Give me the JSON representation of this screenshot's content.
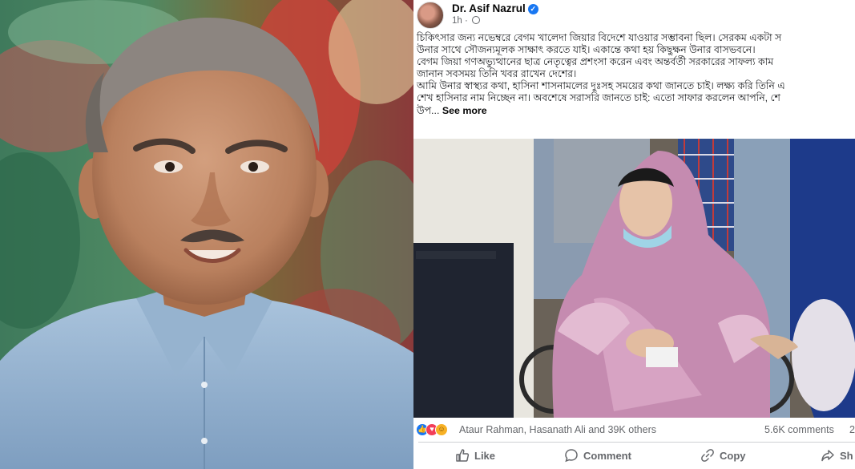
{
  "post": {
    "author": "Dr. Asif Nazrul",
    "time": "1h",
    "text_lines": [
      "চিকিৎসার জন্য নভেম্বরে বেগম খালেদা জিয়ার বিদেশে যাওয়ার সম্ভাবনা ছিল। সেরকম একটা স",
      "উনার সাথে সৌজন্যমূলক সাক্ষাৎ করতে যাই। একান্তে কথা হয় কিছুক্ষন উনার বাসভবনে।",
      "বেগম জিয়া গণঅভ্যুত্থানের ছাত্র নেতৃত্বের প্রশংসা করেন এবং অন্তর্বর্তী সরকারের সাফল্য কাম",
      "জানান সবসময় তিনি খবর রাখেন দেশের।",
      "আমি উনার স্বাস্থ্যর কথা, হাসিনা শাসনামলের দুঃসহ সময়ের কথা জানতে চাই। লক্ষ্য করি তিনি এ",
      "শেখ হাসিনার নাম নিচ্ছেন না। অবশেষে সরাসরি জানতে চাই: এতো সাফার করলেন আপনি, শে"
    ],
    "last_line": "উপ...",
    "see_more": "See more"
  },
  "reactions": {
    "names": "Ataur Rahman, Hasanath Ali and 39K others",
    "comments": "5.6K comments",
    "shares": "2"
  },
  "actions": {
    "like": "Like",
    "comment": "Comment",
    "copy": "Copy",
    "share": "Sh"
  },
  "colors": {
    "facebook_blue": "#1877f2",
    "text_secondary": "#65676b",
    "hijab_pink": "#c98bb0"
  }
}
